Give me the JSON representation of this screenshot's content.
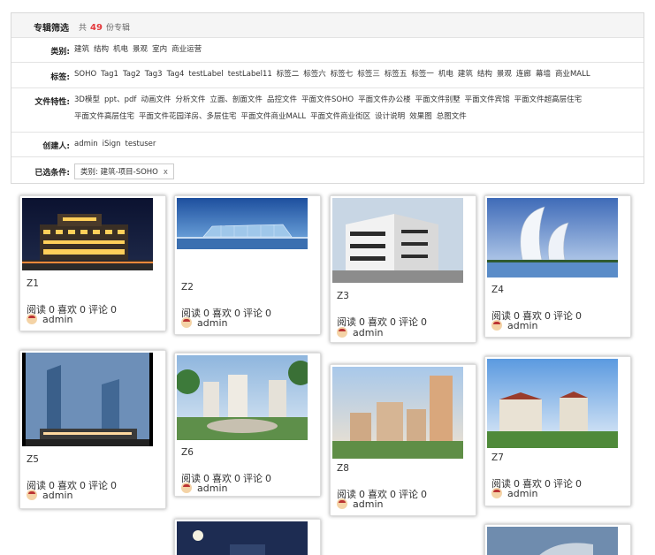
{
  "header": {
    "title": "专辑筛选",
    "count_prefix": "共",
    "count": "49",
    "count_suffix": "份专辑"
  },
  "filters": {
    "category": {
      "label": "类别:",
      "options": [
        "建筑",
        "结构",
        "机电",
        "景观",
        "室内",
        "商业运营"
      ]
    },
    "tags": {
      "label": "标签:",
      "options": [
        "SOHO",
        "Tag1",
        "Tag2",
        "Tag3",
        "Tag4",
        "testLabel",
        "testLabel11",
        "标签二",
        "标签六",
        "标签七",
        "标签三",
        "标签五",
        "标签一",
        "机电",
        "建筑",
        "结构",
        "景观",
        "连廊",
        "幕墙",
        "商业MALL"
      ]
    },
    "file_features": {
      "label": "文件特性:",
      "options": [
        "3D模型",
        "ppt、pdf",
        "动画文件",
        "分析文件",
        "立面、剖面文件",
        "品控文件",
        "平面文件SOHO",
        "平面文件办公楼",
        "平面文件别墅",
        "平面文件宾馆",
        "平面文件超高层住宅",
        "平面文件高层住宅",
        "平面文件花园洋房、多层住宅",
        "平面文件商业MALL",
        "平面文件商业街区",
        "设计说明",
        "效果图",
        "总图文件"
      ]
    },
    "creator": {
      "label": "创建人:",
      "options": [
        "admin",
        "iSign",
        "testuser"
      ]
    },
    "selected": {
      "label": "已选条件:",
      "chip": "类别: 建筑-项目-SOHO",
      "close": "x"
    }
  },
  "stat_labels": {
    "read": "阅读",
    "like": "喜欢",
    "comment": "评论"
  },
  "cards": [
    {
      "title": "Z1",
      "read": "0",
      "like": "0",
      "comment": "0",
      "author": "admin",
      "image": "night-building"
    },
    {
      "title": "Z2",
      "read": "0",
      "like": "0",
      "comment": "0",
      "author": "admin",
      "image": "glass-pavilion"
    },
    {
      "title": "Z3",
      "read": "0",
      "like": "0",
      "comment": "0",
      "author": "admin",
      "image": "white-modern-building"
    },
    {
      "title": "Z4",
      "read": "0",
      "like": "0",
      "comment": "0",
      "author": "admin",
      "image": "sail-towers"
    },
    {
      "title": "Z5",
      "read": "0",
      "like": "0",
      "comment": "0",
      "author": "admin",
      "image": "glass-towers"
    },
    {
      "title": "Z6",
      "read": "0",
      "like": "0",
      "comment": "0",
      "author": "admin",
      "image": "residential-plaza"
    },
    {
      "title": "Z8",
      "read": "0",
      "like": "0",
      "comment": "0",
      "author": "admin",
      "image": "residential-complex"
    },
    {
      "title": "Z7",
      "read": "0",
      "like": "0",
      "comment": "0",
      "author": "admin",
      "image": "apartment-blocks"
    },
    {
      "image": "night-moon-building"
    },
    {
      "image": "curved-building"
    }
  ]
}
